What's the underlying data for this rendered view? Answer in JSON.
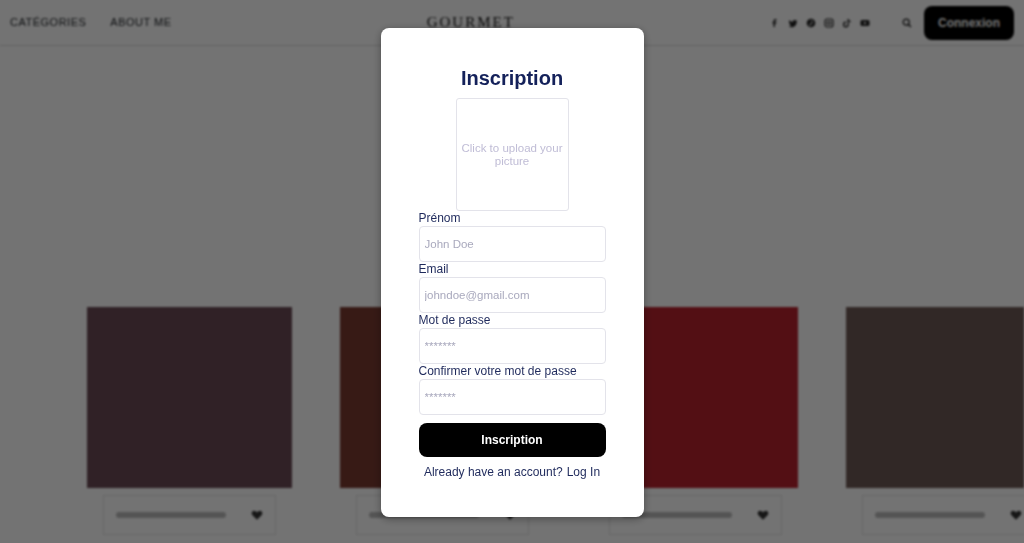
{
  "navbar": {
    "links": [
      "CATÉGORIES",
      "ABOUT ME"
    ],
    "logo": "GOURMET",
    "login_button": "Connexion"
  },
  "cards": [
    {
      "color": "#6a4a55"
    },
    {
      "color": "#7a3a30"
    },
    {
      "color": "#b8222e"
    },
    {
      "color": "#6e5a55"
    }
  ],
  "modal": {
    "title": "Inscription",
    "upload": "Click to upload your picture",
    "fields": [
      {
        "label": "Prénom",
        "placeholder": "John Doe",
        "kind": "text"
      },
      {
        "label": "Email",
        "placeholder": "johndoe@gmail.com",
        "kind": "email"
      },
      {
        "label": "Mot de passe",
        "placeholder": "*******",
        "kind": "password"
      },
      {
        "label": "Confirmer votre mot de passe",
        "placeholder": "*******",
        "kind": "password"
      }
    ],
    "submit": "Inscription",
    "footer": {
      "prompt": "Already have an account?",
      "link": "Log In"
    }
  }
}
